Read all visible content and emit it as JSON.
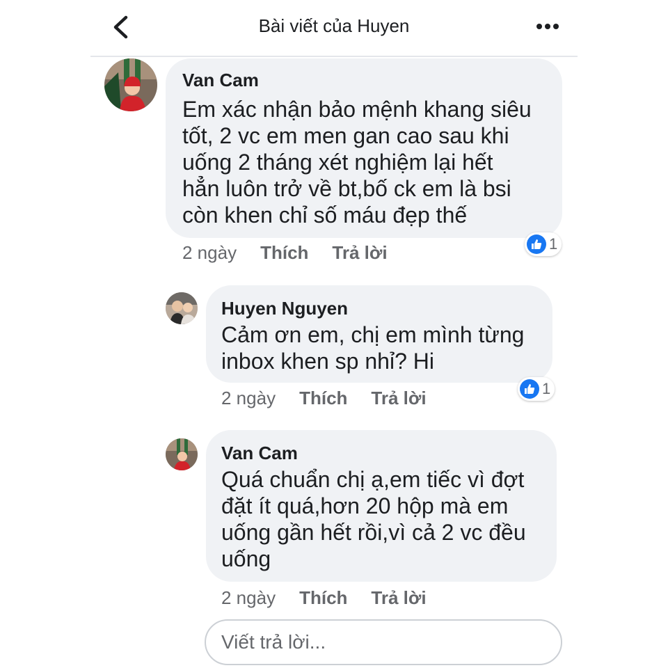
{
  "header": {
    "title": "Bài viết của Huyen",
    "back_icon": "chevron-left-icon",
    "more_icon": "more-horizontal-icon"
  },
  "comments": [
    {
      "author": "Van Cam",
      "lines": [
        "Em xác nhận bảo mệnh khang siêu",
        "tốt, 2 vc em men gan cao sau khi",
        "uống 2 tháng xét nghiệm lại hết",
        "hẳn luôn trở về bt,bố ck em là bsi",
        "còn khen chỉ số máu đẹp thế"
      ],
      "time": "2 ngày",
      "like_label": "Thích",
      "reply_label": "Trả lời",
      "reaction_count": "1"
    },
    {
      "author": "Huyen Nguyen",
      "lines": [
        "Cảm ơn em, chị em mình từng",
        "inbox khen sp nhỉ? Hi"
      ],
      "time": "2 ngày",
      "like_label": "Thích",
      "reply_label": "Trả lời",
      "reaction_count": "1"
    },
    {
      "author": "Van Cam",
      "lines": [
        "Quá chuẩn chị ạ,em tiếc vì đợt",
        "đặt ít quá,hơn 20 hộp mà em",
        "uống gần hết rồi,vì cả 2 vc đều",
        "uống"
      ],
      "time": "2 ngày",
      "like_label": "Thích",
      "reply_label": "Trả lời"
    }
  ],
  "reply_input": {
    "placeholder": "Viết trả lời..."
  },
  "colors": {
    "bubble": "#f0f2f5",
    "like_blue": "#1877f2",
    "meta_text": "#65676b"
  }
}
